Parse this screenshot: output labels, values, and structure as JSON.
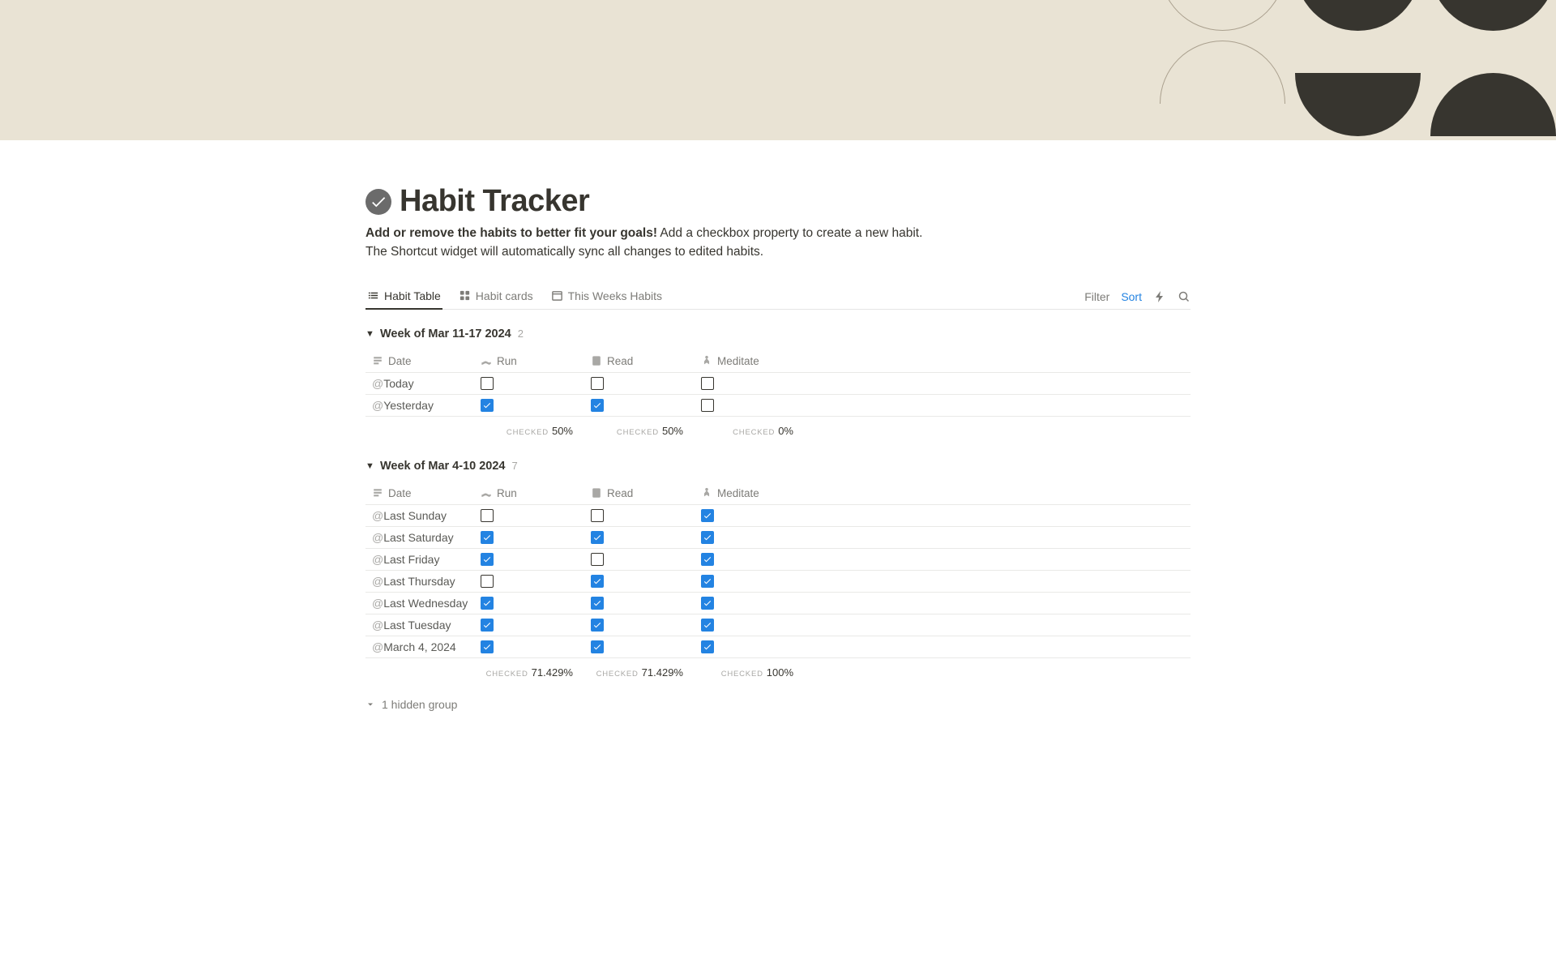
{
  "page": {
    "title": "Habit Tracker",
    "description_bold": "Add or remove the habits to better fit your goals!",
    "description_rest": " Add a checkbox property to create a new habit.",
    "description_line2": "The Shortcut widget will automatically sync all changes to edited habits."
  },
  "tabs": {
    "habit_table": "Habit Table",
    "habit_cards": "Habit cards",
    "this_weeks": "This Weeks Habits"
  },
  "toolbar": {
    "filter": "Filter",
    "sort": "Sort"
  },
  "columns": {
    "date": "Date",
    "run": "Run",
    "read": "Read",
    "meditate": "Meditate"
  },
  "summary_label": "CHECKED",
  "groups": [
    {
      "title": "Week of Mar 11-17 2024",
      "count": "2",
      "rows": [
        {
          "date": "Today",
          "run": false,
          "read": false,
          "meditate": false
        },
        {
          "date": "Yesterday",
          "run": true,
          "read": true,
          "meditate": false
        }
      ],
      "summary": {
        "run": "50%",
        "read": "50%",
        "meditate": "0%"
      }
    },
    {
      "title": "Week of Mar 4-10 2024",
      "count": "7",
      "rows": [
        {
          "date": "Last Sunday",
          "run": false,
          "read": false,
          "meditate": true
        },
        {
          "date": "Last Saturday",
          "run": true,
          "read": true,
          "meditate": true
        },
        {
          "date": "Last Friday",
          "run": true,
          "read": false,
          "meditate": true
        },
        {
          "date": "Last Thursday",
          "run": false,
          "read": true,
          "meditate": true
        },
        {
          "date": "Last Wednesday",
          "run": true,
          "read": true,
          "meditate": true
        },
        {
          "date": "Last Tuesday",
          "run": true,
          "read": true,
          "meditate": true
        },
        {
          "date": "March 4, 2024",
          "run": true,
          "read": true,
          "meditate": true
        }
      ],
      "summary": {
        "run": "71.429%",
        "read": "71.429%",
        "meditate": "100%"
      }
    }
  ],
  "hidden_group_label": "1 hidden group"
}
